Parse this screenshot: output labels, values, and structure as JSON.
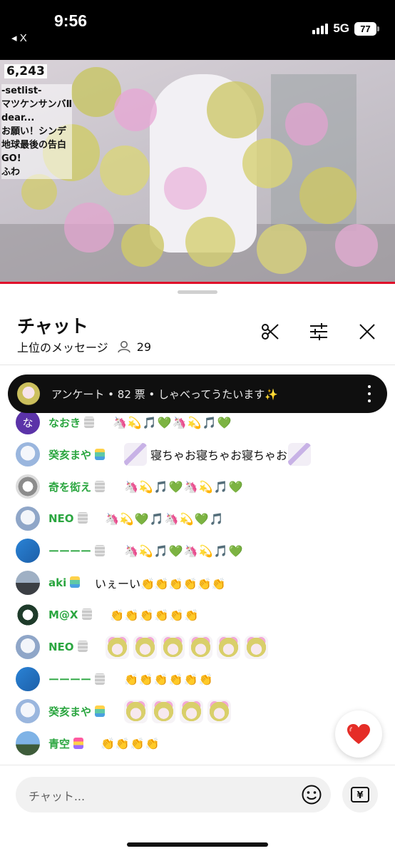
{
  "status_bar": {
    "time": "9:56",
    "back_app": "◂ X",
    "network": "5G",
    "battery": "77"
  },
  "video": {
    "viewer_count": "6,243",
    "overlay_text": "-setlist-\nマツケンサンバⅡ\ndear...\nお願い！シンデ\n地球最後の告白\nGO!\nふわ"
  },
  "chat": {
    "title": "チャット",
    "mode_label": "上位のメッセージ",
    "viewer_count": "29",
    "icons": [
      "scissors-icon",
      "tune-icon",
      "close-icon"
    ]
  },
  "poll": {
    "text": "アンケート • 82 票 • しゃべってうたいます✨"
  },
  "messages": [
    {
      "author": "なおき",
      "text": "🦄💫🎵💚🦄💫🎵💚",
      "badge": "gray"
    },
    {
      "author": "癸亥まや",
      "text": "寝ちゃお寝ちゃお寝ちゃお",
      "badge": "teal"
    },
    {
      "author": "奇を衒え",
      "text": "🦄💫🎵💚🦄💫🎵💚",
      "badge": "gray"
    },
    {
      "author": "NEO",
      "text": "🦄💫💚🎵🦄💫💚🎵",
      "badge": "gray"
    },
    {
      "author": "ーーーー",
      "text": "🦄💫🎵💚🦄💫🎵💚",
      "badge": "gray"
    },
    {
      "author": "aki",
      "text": "いぇーい👏👏👏👏👏👏",
      "badge": "teal"
    },
    {
      "author": "M@X",
      "text": "👏👏👏👏👏👏",
      "badge": "gray"
    },
    {
      "author": "NEO",
      "text": "",
      "badge": "gray"
    },
    {
      "author": "ーーーー",
      "text": "👏👏👏👏👏👏",
      "badge": "gray"
    },
    {
      "author": "癸亥まや",
      "text": "",
      "badge": "teal"
    },
    {
      "author": "青空",
      "text": "👏👏👏👏",
      "badge": "rainbow"
    }
  ],
  "input": {
    "placeholder": "チャット..."
  },
  "superchat_symbol": "¥",
  "colors": {
    "author_green": "#2ba640",
    "heart_red": "#e52d27",
    "poll_bg": "#0f0f0f"
  }
}
